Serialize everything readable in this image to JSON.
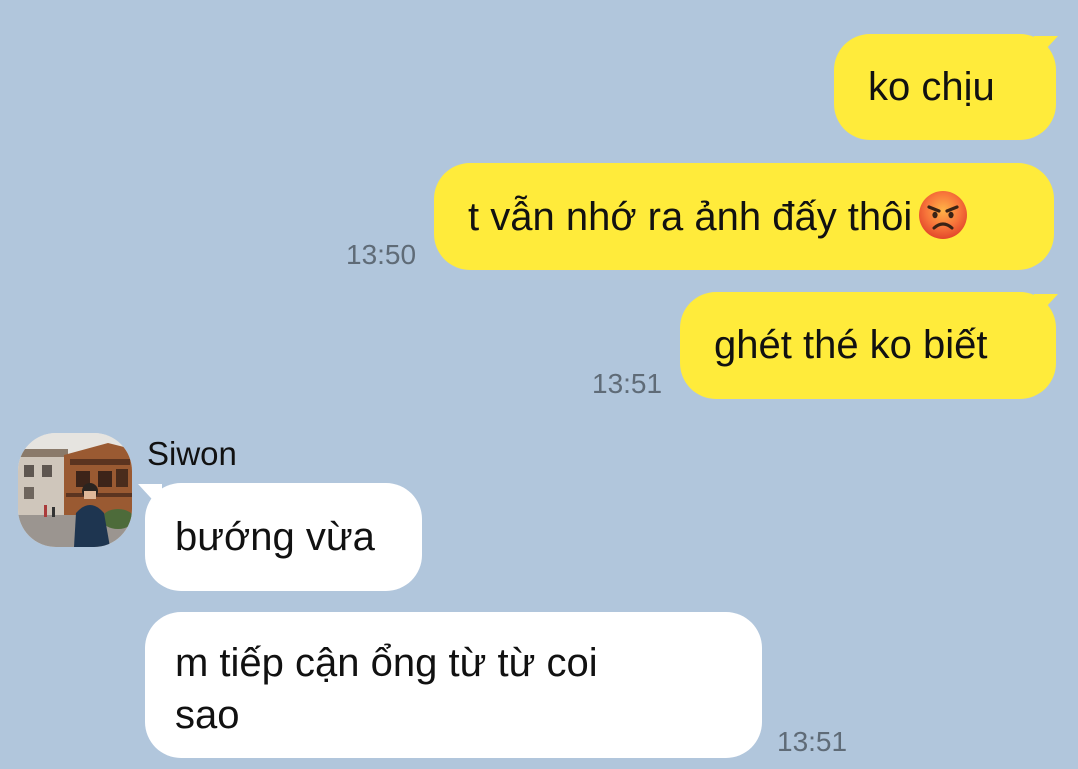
{
  "messages": [
    {
      "text": "ko chịu"
    },
    {
      "text": "t vẫn nhớ ra ảnh đấy thôi",
      "emoji": "angry-face-emoji",
      "time": "13:50"
    },
    {
      "text": "ghét thé ko biết",
      "time": "13:51"
    },
    {
      "sender": "Siwon",
      "text": "bướng vừa"
    },
    {
      "text_line1": "m tiếp cận ổng từ từ coi",
      "text_line2": "sao",
      "time": "13:51"
    }
  ],
  "colors": {
    "background": "#b1c6dc",
    "outgoing_bubble": "#ffeb3b",
    "incoming_bubble": "#ffffff",
    "timestamp": "#5f6b77"
  },
  "icons": {
    "avatar": "siwon-avatar",
    "emoji": "angry-face-emoji"
  }
}
